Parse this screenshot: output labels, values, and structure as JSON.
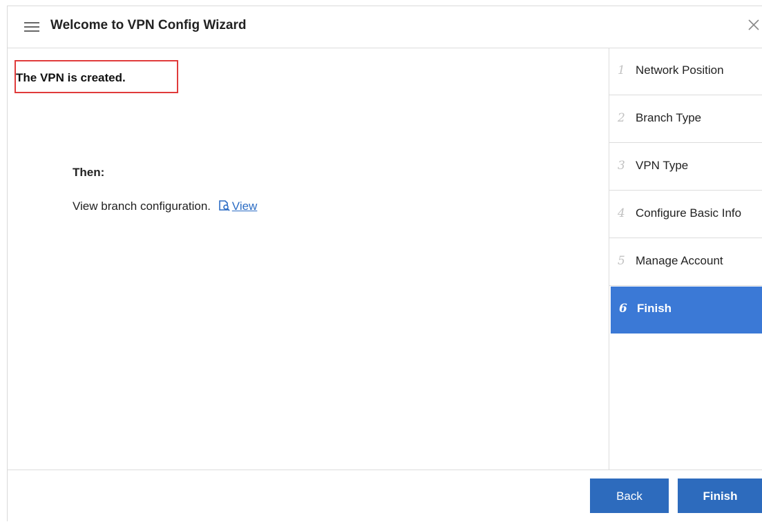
{
  "dialog": {
    "title": "Welcome to VPN Config Wizard",
    "menu_icon": "hamburger-icon",
    "close_icon": "close-icon"
  },
  "main": {
    "status_message": "The VPN is created.",
    "then_heading": "Then:",
    "view_text": "View branch configuration.",
    "view_icon": "view-document-icon",
    "view_link": "View"
  },
  "steps": [
    {
      "num": "1",
      "label": "Network Position",
      "active": false
    },
    {
      "num": "2",
      "label": "Branch Type",
      "active": false
    },
    {
      "num": "3",
      "label": "VPN Type",
      "active": false
    },
    {
      "num": "4",
      "label": "Configure Basic Info",
      "active": false
    },
    {
      "num": "5",
      "label": "Manage Account",
      "active": false
    },
    {
      "num": "6",
      "label": "Finish",
      "active": true
    }
  ],
  "footer": {
    "back_label": "Back",
    "finish_label": "Finish"
  },
  "colors": {
    "accent": "#3b79d6",
    "button": "#2d6bbd",
    "highlight_border": "#e03a3a",
    "link": "#2b6cc4"
  }
}
